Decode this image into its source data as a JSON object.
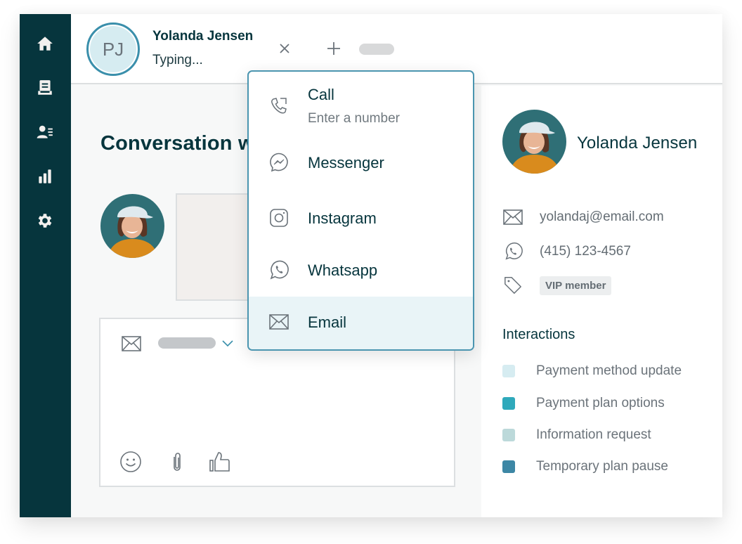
{
  "sidebar": {
    "items": [
      {
        "name": "home",
        "icon": "home-icon"
      },
      {
        "name": "inbox",
        "icon": "inbox-tray-icon"
      },
      {
        "name": "contacts",
        "icon": "contact-list-icon"
      },
      {
        "name": "reports",
        "icon": "bar-chart-icon"
      },
      {
        "name": "settings",
        "icon": "gear-icon"
      }
    ]
  },
  "header": {
    "avatar_initials": "PJ",
    "contact_name": "Yolanda Jensen",
    "status": "Typing...",
    "close_icon": "close-icon",
    "add_icon": "plus-icon"
  },
  "conversation": {
    "title": "Conversation with Yolanda Jensen"
  },
  "composer": {
    "channel_icon": "mail-icon",
    "tools": [
      {
        "name": "emoji",
        "icon": "smiley-icon"
      },
      {
        "name": "attach",
        "icon": "paperclip-icon"
      },
      {
        "name": "like",
        "icon": "thumbs-up-icon"
      }
    ]
  },
  "channel_menu": {
    "items": [
      {
        "label": "Call",
        "sublabel": "Enter a number",
        "icon": "phone-icon",
        "selected": false
      },
      {
        "label": "Messenger",
        "icon": "messenger-icon",
        "selected": false
      },
      {
        "label": "Instagram",
        "icon": "instagram-icon",
        "selected": false
      },
      {
        "label": "Whatsapp",
        "icon": "whatsapp-icon",
        "selected": false
      },
      {
        "label": "Email",
        "icon": "mail-icon",
        "selected": true
      }
    ]
  },
  "profile": {
    "name": "Yolanda Jensen",
    "email": "yolandaj@email.com",
    "phone": "(415) 123-4567",
    "tag": "VIP member"
  },
  "interactions": {
    "title": "Interactions",
    "items": [
      {
        "label": "Payment method update",
        "color": "#d6ecf1"
      },
      {
        "label": "Payment plan options",
        "color": "#2fa9bb"
      },
      {
        "label": "Information request",
        "color": "#bcd9da"
      },
      {
        "label": "Temporary plan pause",
        "color": "#3d87a5"
      }
    ]
  },
  "colors": {
    "sidebar": "#06353d",
    "accent": "#4b95b0",
    "selected_row": "#e9f4f7",
    "heading": "#06353d"
  }
}
